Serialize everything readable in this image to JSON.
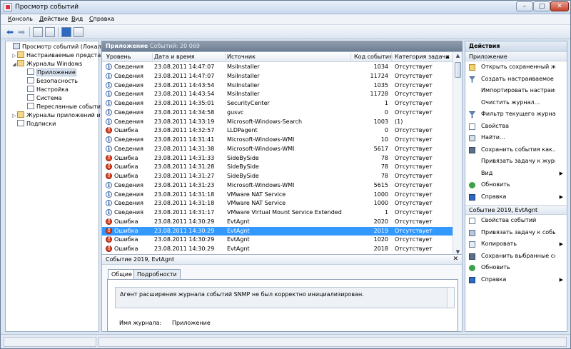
{
  "window": {
    "title": "Просмотр событий",
    "min": "–",
    "max": "□",
    "close": "✕"
  },
  "menu": [
    {
      "u": "К",
      "rest": "онсоль"
    },
    {
      "u": "Д",
      "rest": "ействие"
    },
    {
      "u": "В",
      "rest": "ид"
    },
    {
      "u": "С",
      "rest": "правка"
    }
  ],
  "toolbar": {
    "back": "⬅",
    "forward": "➡"
  },
  "tree": [
    {
      "label": "Просмотр событий (Локальный",
      "exp": "",
      "indent": 0,
      "icon": "ev"
    },
    {
      "label": "Настраиваемые представле",
      "exp": "▷",
      "indent": 1,
      "icon": "folder"
    },
    {
      "label": "Журналы Windows",
      "exp": "◢",
      "indent": 1,
      "icon": "folder"
    },
    {
      "label": "Приложение",
      "exp": "",
      "indent": 2,
      "icon": "log",
      "selected": true
    },
    {
      "label": "Безопасность",
      "exp": "",
      "indent": 2,
      "icon": "log"
    },
    {
      "label": "Настройка",
      "exp": "",
      "indent": 2,
      "icon": "log"
    },
    {
      "label": "Система",
      "exp": "",
      "indent": 2,
      "icon": "log"
    },
    {
      "label": "Пересланные события",
      "exp": "",
      "indent": 2,
      "icon": "log"
    },
    {
      "label": "Журналы приложений и сл",
      "exp": "▷",
      "indent": 1,
      "icon": "folder"
    },
    {
      "label": "Подписки",
      "exp": "",
      "indent": 1,
      "icon": "log"
    }
  ],
  "list": {
    "name": "Приложение",
    "count": "Событий: 20 069",
    "columns": [
      "Уровень",
      "Дата и время",
      "Источник",
      "Код события",
      "Категория задачи"
    ],
    "rows": [
      {
        "lvl": "info",
        "level": "Сведения",
        "date": "23.08.2011 14:47:07",
        "source": "MsiInstaller",
        "code": "1034",
        "cat": "Отсутствует"
      },
      {
        "lvl": "info",
        "level": "Сведения",
        "date": "23.08.2011 14:47:07",
        "source": "MsiInstaller",
        "code": "11724",
        "cat": "Отсутствует"
      },
      {
        "lvl": "info",
        "level": "Сведения",
        "date": "23.08.2011 14:43:54",
        "source": "MsiInstaller",
        "code": "1035",
        "cat": "Отсутствует"
      },
      {
        "lvl": "info",
        "level": "Сведения",
        "date": "23.08.2011 14:43:54",
        "source": "MsiInstaller",
        "code": "11728",
        "cat": "Отсутствует"
      },
      {
        "lvl": "info",
        "level": "Сведения",
        "date": "23.08.2011 14:35:01",
        "source": "SecurityCenter",
        "code": "1",
        "cat": "Отсутствует"
      },
      {
        "lvl": "info",
        "level": "Сведения",
        "date": "23.08.2011 14:34:58",
        "source": "gusvc",
        "code": "0",
        "cat": "Отсутствует"
      },
      {
        "lvl": "info",
        "level": "Сведения",
        "date": "23.08.2011 14:33:19",
        "source": "Microsoft-Windows-Search",
        "code": "1003",
        "cat": "(1)"
      },
      {
        "lvl": "err",
        "level": "Ошибка",
        "date": "23.08.2011 14:32:57",
        "source": "LLDPagent",
        "code": "0",
        "cat": "Отсутствует"
      },
      {
        "lvl": "info",
        "level": "Сведения",
        "date": "23.08.2011 14:31:41",
        "source": "Microsoft-Windows-WMI",
        "code": "10",
        "cat": "Отсутствует"
      },
      {
        "lvl": "info",
        "level": "Сведения",
        "date": "23.08.2011 14:31:38",
        "source": "Microsoft-Windows-WMI",
        "code": "5617",
        "cat": "Отсутствует"
      },
      {
        "lvl": "err",
        "level": "Ошибка",
        "date": "23.08.2011 14:31:33",
        "source": "SideBySide",
        "code": "78",
        "cat": "Отсутствует"
      },
      {
        "lvl": "err",
        "level": "Ошибка",
        "date": "23.08.2011 14:31:28",
        "source": "SideBySide",
        "code": "78",
        "cat": "Отсутствует"
      },
      {
        "lvl": "err",
        "level": "Ошибка",
        "date": "23.08.2011 14:31:27",
        "source": "SideBySide",
        "code": "78",
        "cat": "Отсутствует"
      },
      {
        "lvl": "info",
        "level": "Сведения",
        "date": "23.08.2011 14:31:23",
        "source": "Microsoft-Windows-WMI",
        "code": "5615",
        "cat": "Отсутствует"
      },
      {
        "lvl": "info",
        "level": "Сведения",
        "date": "23.08.2011 14:31:18",
        "source": "VMware NAT Service",
        "code": "1000",
        "cat": "Отсутствует"
      },
      {
        "lvl": "info",
        "level": "Сведения",
        "date": "23.08.2011 14:31:18",
        "source": "VMware NAT Service",
        "code": "1000",
        "cat": "Отсутствует"
      },
      {
        "lvl": "info",
        "level": "Сведения",
        "date": "23.08.2011 14:31:17",
        "source": "VMware Virtual Mount Service Extended",
        "code": "1",
        "cat": "Отсутствует"
      },
      {
        "lvl": "err",
        "level": "Ошибка",
        "date": "23.08.2011 14:30:29",
        "source": "EvtAgnt",
        "code": "2020",
        "cat": "Отсутствует"
      },
      {
        "lvl": "err",
        "level": "Ошибка",
        "date": "23.08.2011 14:30:29",
        "source": "EvtAgnt",
        "code": "2019",
        "cat": "Отсутствует",
        "selected": true
      },
      {
        "lvl": "err",
        "level": "Ошибка",
        "date": "23.08.2011 14:30:29",
        "source": "EvtAgnt",
        "code": "1020",
        "cat": "Отсутствует"
      },
      {
        "lvl": "err",
        "level": "Ошибка",
        "date": "23.08.2011 14:30:29",
        "source": "EvtAgnt",
        "code": "2018",
        "cat": "Отсутствует"
      }
    ]
  },
  "detail": {
    "title": "Событие 2019, EvtAgnt",
    "close": "✕",
    "tabs": [
      "Общие",
      "Подробности"
    ],
    "description": "Агент расширения журнала событий SNMP не был корректно инициализирован.",
    "log_label": "Имя журнала:",
    "log_value": "Приложение"
  },
  "actions": {
    "title": "Действия",
    "sections": [
      {
        "title": "Приложение",
        "items": [
          {
            "label": "Открыть сохраненный жу...",
            "icon": "folder"
          },
          {
            "label": "Создать настраиваемое п...",
            "icon": "filter"
          },
          {
            "label": "Импортировать настраив...",
            "icon": "blank"
          },
          {
            "label": "Очистить журнал...",
            "icon": "blank"
          },
          {
            "label": "Фильтр текущего журнал...",
            "icon": "filter"
          },
          {
            "label": "Свойства",
            "icon": "props"
          },
          {
            "label": "Найти...",
            "icon": "find"
          },
          {
            "label": "Сохранить события как...",
            "icon": "save"
          },
          {
            "label": "Привязать задачу к журна...",
            "icon": "blank"
          },
          {
            "label": "Вид",
            "icon": "blank",
            "sub": true
          },
          {
            "label": "Обновить",
            "icon": "refresh"
          },
          {
            "label": "Справка",
            "icon": "help",
            "sub": true
          }
        ]
      },
      {
        "title": "Событие 2019, EvtAgnt",
        "items": [
          {
            "label": "Свойства событий",
            "icon": "props"
          },
          {
            "label": "Привязать задачу к событ...",
            "icon": "task"
          },
          {
            "label": "Копировать",
            "icon": "copy",
            "sub": true
          },
          {
            "label": "Сохранить выбранные со...",
            "icon": "save"
          },
          {
            "label": "Обновить",
            "icon": "refresh"
          },
          {
            "label": "Справка",
            "icon": "help",
            "sub": true
          }
        ]
      }
    ]
  }
}
